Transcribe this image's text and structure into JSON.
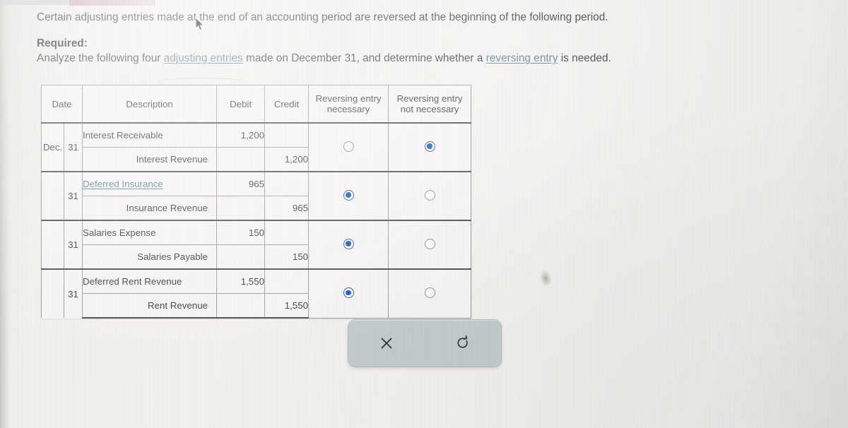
{
  "prose": {
    "intro": "Certain adjusting entries made at the end of an accounting period are reversed at the beginning of the following period.",
    "required_label": "Required:",
    "analyze_part1": "Analyze the following four ",
    "analyze_link1": "adjusting entries",
    "analyze_part2": " made on December 31, and determine whether a ",
    "analyze_link2": "reversing entry",
    "analyze_part3": " is needed."
  },
  "table": {
    "headers": {
      "date": "Date",
      "description": "Description",
      "debit": "Debit",
      "credit": "Credit",
      "reversing_necessary": "Reversing entry\nnecessary",
      "reversing_necessary_line1": "Reversing entry",
      "reversing_necessary_line2": "necessary",
      "reversing_not_necessary_line1": "Reversing entry",
      "reversing_not_necessary_line2": "not necessary"
    },
    "entries": [
      {
        "month": "Dec.",
        "day": "31",
        "debit_account": "Interest Receivable",
        "debit_account_is_link": false,
        "debit_amount": "1,200",
        "credit_account": "Interest Revenue",
        "credit_amount": "1,200",
        "selected": "not_necessary"
      },
      {
        "month": "",
        "day": "31",
        "debit_account": "Deferred Insurance",
        "debit_account_is_link": true,
        "debit_amount": "965",
        "credit_account": "Insurance Revenue",
        "credit_amount": "965",
        "selected": "necessary"
      },
      {
        "month": "",
        "day": "31",
        "debit_account": "Salaries Expense",
        "debit_account_is_link": false,
        "debit_amount": "150",
        "credit_account": "Salaries Payable",
        "credit_amount": "150",
        "selected": "necessary"
      },
      {
        "month": "",
        "day": "31",
        "debit_account": "Deferred Rent Revenue",
        "debit_account_is_link": false,
        "debit_amount": "1,550",
        "credit_account": "Rent Revenue",
        "credit_amount": "1,550",
        "selected": "necessary"
      }
    ]
  },
  "actions": {
    "clear_label": "×",
    "clear_name": "clear-answers",
    "reset_label": "↺",
    "reset_name": "reset-answers"
  },
  "colors": {
    "link": "#5c7f8e",
    "radio_selected": "#1455c4",
    "radio_border": "#8d8d8d",
    "table_border": "#4a4a4a",
    "panel_bg": "#c3cbcd",
    "page_bg": "#f2f0ec"
  }
}
